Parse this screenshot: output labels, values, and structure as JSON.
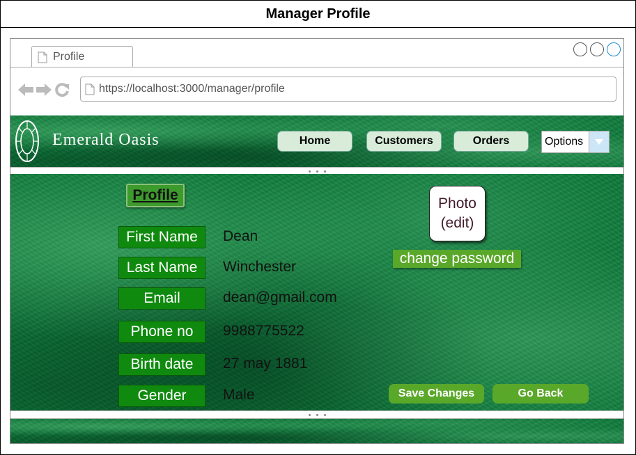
{
  "frame": {
    "title": "Manager Profile"
  },
  "browser": {
    "tab_title": "Profile",
    "url": "https://localhost:3000/manager/profile"
  },
  "header": {
    "brand": "Emerald Oasis",
    "nav": {
      "home": "Home",
      "customers": "Customers",
      "orders": "Orders"
    },
    "options": {
      "selected": "Options"
    }
  },
  "profile": {
    "heading": "Profile",
    "fields": {
      "first_name": {
        "label": "First Name",
        "value": "Dean"
      },
      "last_name": {
        "label": "Last Name",
        "value": "Winchester"
      },
      "email": {
        "label": "Email",
        "value": "dean@gmail.com"
      },
      "phone": {
        "label": "Phone no",
        "value": "9988775522"
      },
      "birth_date": {
        "label": "Birth date",
        "value": "27 may 1881"
      },
      "gender": {
        "label": "Gender",
        "value": "Male"
      }
    },
    "photo_line1": "Photo",
    "photo_line2": "(edit)",
    "change_password": "change password",
    "save_changes": "Save Changes",
    "go_back": "Go Back"
  },
  "colors": {
    "banner_green": "#0d7a3a",
    "label_green": "#0f8a0f",
    "button_green": "#5aa82a",
    "nav_button": "#d8ecd9"
  }
}
